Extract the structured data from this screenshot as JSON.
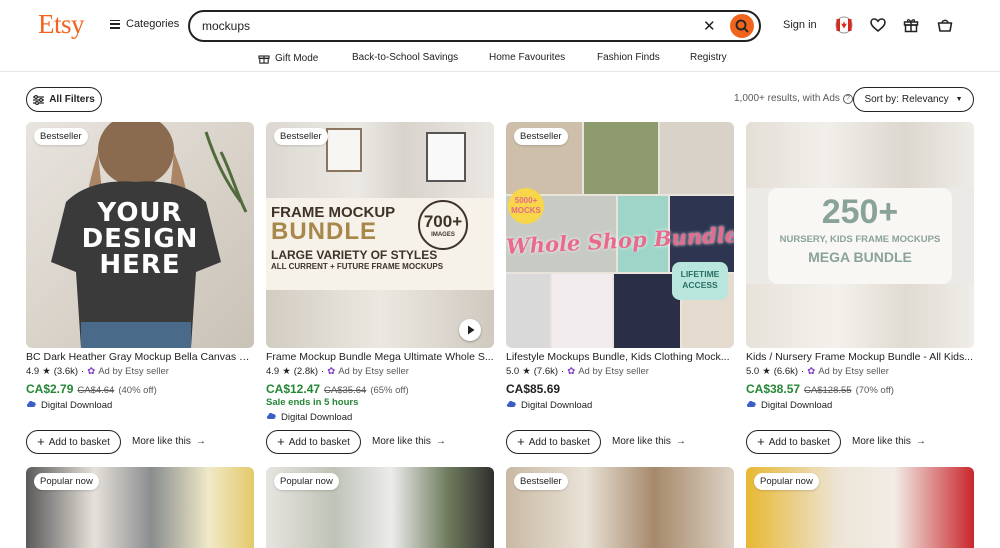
{
  "header": {
    "logo": "Etsy",
    "categories_label": "Categories",
    "search_value": "mockups",
    "signin_label": "Sign in"
  },
  "subnav": [
    "Gift Mode",
    "Back-to-School Savings",
    "Home Favourites",
    "Fashion Finds",
    "Registry"
  ],
  "filters": {
    "all_filters_label": "All Filters",
    "results_text": "1,000+ results, with Ads",
    "sort_prefix": "Sort by:",
    "sort_value": "Relevancy"
  },
  "colors": {
    "accent": "#f1641e",
    "sale": "#258635",
    "text": "#222222"
  },
  "listings": [
    {
      "badge": "Bestseller",
      "title": "BC Dark Heather Gray Mockup Bella Canvas D...",
      "rating": "4.9",
      "reviews": "(3.6k)",
      "ad_text": "Ad by Etsy seller",
      "price": "CA$2.79",
      "original_price": "CA$4.64",
      "discount": "(40% off)",
      "sale_end": "",
      "download_label": "Digital Download",
      "image_text": [
        "YOUR",
        "DESIGN",
        "HERE"
      ]
    },
    {
      "badge": "Bestseller",
      "title": "Frame Mockup Bundle Mega Ultimate Whole S...",
      "rating": "4.9",
      "reviews": "(2.8k)",
      "ad_text": "Ad by Etsy seller",
      "price": "CA$12.47",
      "original_price": "CA$35.64",
      "discount": "(65% off)",
      "sale_end": "Sale ends in 5 hours",
      "download_label": "Digital Download",
      "image_text": [
        "FRAME MOCKUP",
        "BUNDLE",
        "LARGE VARIETY OF STYLES",
        "ALL CURRENT + FUTURE FRAME MOCKUPS",
        "700+",
        "IMAGES"
      ]
    },
    {
      "badge": "Bestseller",
      "title": "Lifestyle Mockups Bundle, Kids Clothing Mock...",
      "rating": "5.0",
      "reviews": "(7.6k)",
      "ad_text": "Ad by Etsy seller",
      "price": "CA$85.69",
      "original_price": "",
      "discount": "",
      "sale_end": "",
      "download_label": "Digital Download",
      "image_text": [
        "Whole Shop Bundle",
        "LIFETIME",
        "ACCESS",
        "5000+",
        "MOCKS"
      ]
    },
    {
      "badge": "",
      "title": "Kids / Nursery Frame Mockup Bundle - All Kids...",
      "rating": "5.0",
      "reviews": "(6.6k)",
      "ad_text": "Ad by Etsy seller",
      "price": "CA$38.57",
      "original_price": "CA$128.55",
      "discount": "(70% off)",
      "sale_end": "",
      "download_label": "Digital Download",
      "image_text": [
        "250+",
        "NURSERY, KIDS FRAME MOCKUPS",
        "MEGA BUNDLE"
      ]
    }
  ],
  "actions": {
    "add_label": "Add to basket",
    "more_label": "More like this"
  },
  "second_row_badges": [
    "Popular now",
    "Popular now",
    "Bestseller",
    "Popular now"
  ]
}
